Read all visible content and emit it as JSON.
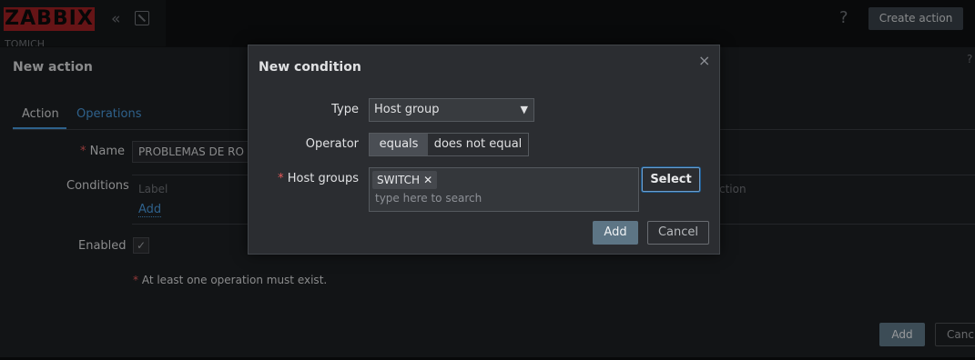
{
  "sidebar": {
    "logo": "ZABBIX",
    "server_name": "TOMICH",
    "collapse_icon": "double-chevron-left-icon",
    "kiosk_icon": "kiosk-mode-icon"
  },
  "header": {
    "help_symbol": "?",
    "create_action_label": "Create action"
  },
  "action_panel": {
    "title": "New action",
    "help_symbol": "?",
    "tabs": [
      {
        "label": "Action",
        "active": true
      },
      {
        "label": "Operations",
        "active": false
      }
    ],
    "required_marker": "*",
    "name_label": "Name",
    "name_value": "PROBLEMAS DE RO",
    "conditions_label": "Conditions",
    "conditions_columns": {
      "label": "Label",
      "action": "ction"
    },
    "conditions_add_link": "Add",
    "enabled_label": "Enabled",
    "enabled_checked": "✓",
    "warning_text": "At least one operation must exist.",
    "add_button": "Add",
    "cancel_button": "Canc"
  },
  "modal": {
    "title": "New condition",
    "close_symbol": "×",
    "type_label": "Type",
    "type_value": "Host group",
    "operator_label": "Operator",
    "operator_options": [
      "equals",
      "does not equal"
    ],
    "operator_selected": "equals",
    "required_marker": "*",
    "host_groups_label": "Host groups",
    "host_groups_selected": [
      "SWITCH"
    ],
    "chip_remove_symbol": "✕",
    "host_groups_placeholder": "type here to search",
    "select_button": "Select",
    "add_button": "Add",
    "cancel_button": "Cancel"
  },
  "colors": {
    "background": "#0e1012",
    "panel": "#1d1f22",
    "modal": "#2b2d31",
    "logo_red": "#9c1f23",
    "link_blue": "#4795d6",
    "primary_button": "#5d7585",
    "required_red": "#e45959"
  }
}
